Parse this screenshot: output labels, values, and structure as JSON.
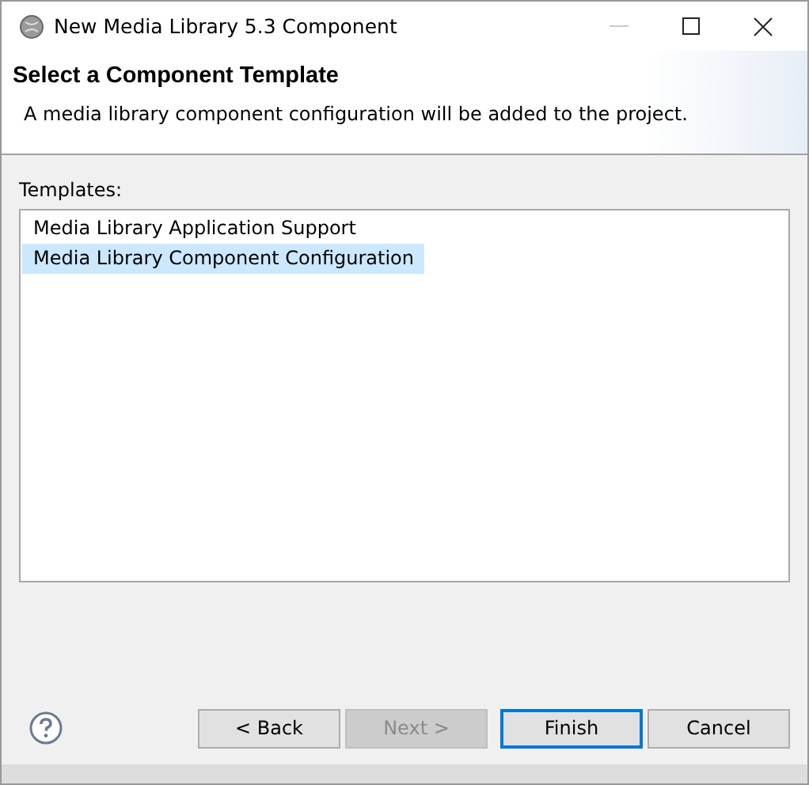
{
  "window": {
    "title": "New Media Library 5.3 Component"
  },
  "header": {
    "title": "Select a Component Template",
    "description": "A media library component configuration will be added to the project."
  },
  "templates": {
    "label": "Templates:",
    "items": [
      {
        "label": "Media Library Application Support",
        "selected": false
      },
      {
        "label": "Media Library Component Configuration",
        "selected": true
      }
    ]
  },
  "buttons": [
    {
      "label": "< Back",
      "disabled": false,
      "default": false
    },
    {
      "label": "Next >",
      "disabled": true,
      "default": false
    },
    {
      "label": "Finish",
      "disabled": false,
      "default": true
    },
    {
      "label": "Cancel",
      "disabled": false,
      "default": false
    }
  ]
}
